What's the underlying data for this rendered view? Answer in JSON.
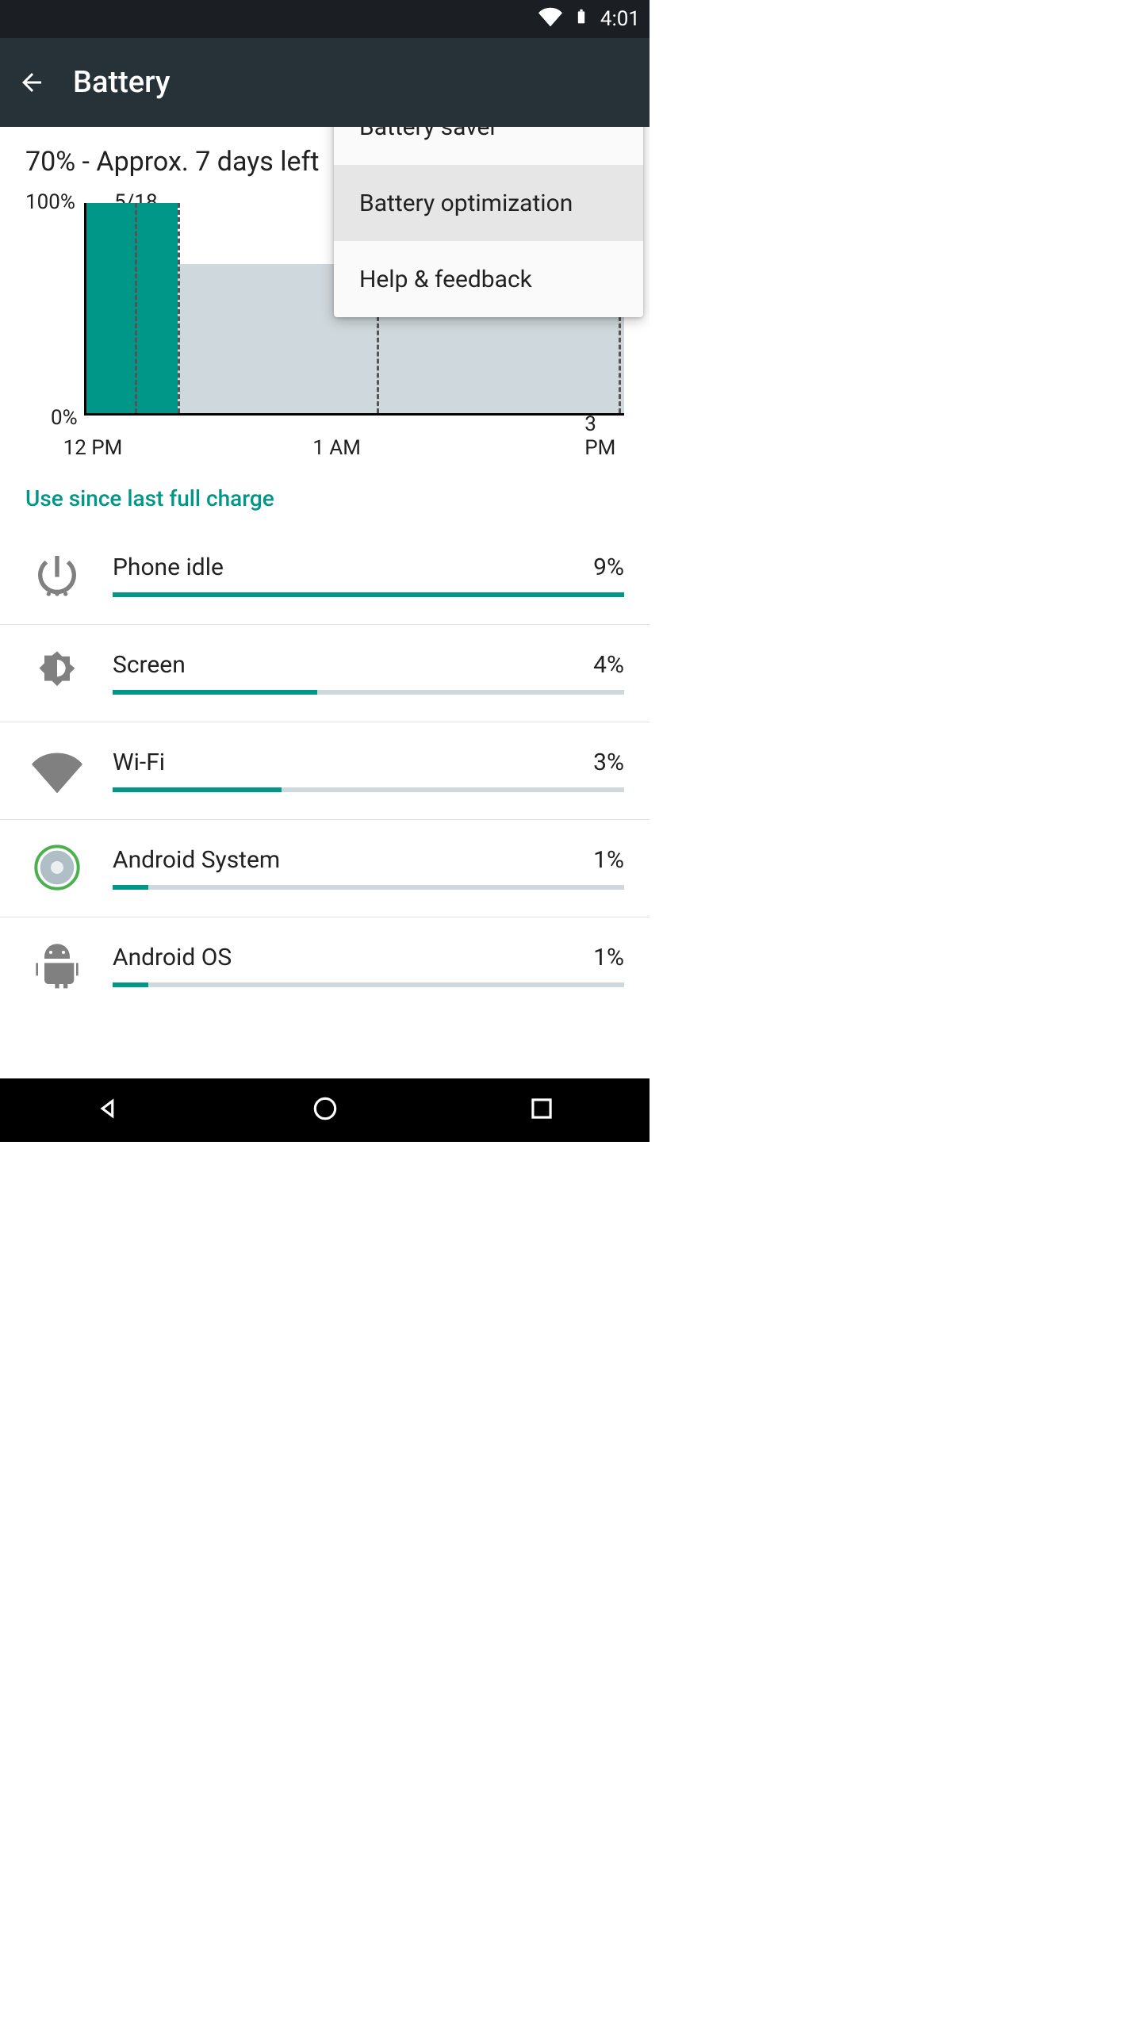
{
  "status": {
    "time": "4:01"
  },
  "appbar": {
    "title": "Battery"
  },
  "menu": {
    "items": [
      "Battery saver",
      "Battery optimization",
      "Help & feedback"
    ],
    "highlighted_index": 1
  },
  "summary": "70% - Approx. 7 days left",
  "chart_data": {
    "type": "area",
    "ylabel_top": "100%",
    "ylabel_bot": "0%",
    "date_label": "5/18",
    "x_ticks": [
      "12 PM",
      "1 AM",
      "3 PM"
    ],
    "now_fraction": 0.17,
    "current_pct": 70,
    "projected_zero_fraction": 1.0,
    "past_start_pct": 98
  },
  "section_title": "Use since last full charge",
  "usage": [
    {
      "icon": "power-icon",
      "label": "Phone idle",
      "pct": 9,
      "bar": 100
    },
    {
      "icon": "brightness-icon",
      "label": "Screen",
      "pct": 4,
      "bar": 40
    },
    {
      "icon": "wifi-icon",
      "label": "Wi-Fi",
      "pct": 3,
      "bar": 33
    },
    {
      "icon": "android-sys-icon",
      "label": "Android System",
      "pct": 1,
      "bar": 7
    },
    {
      "icon": "android-os-icon",
      "label": "Android OS",
      "pct": 1,
      "bar": 7
    }
  ]
}
